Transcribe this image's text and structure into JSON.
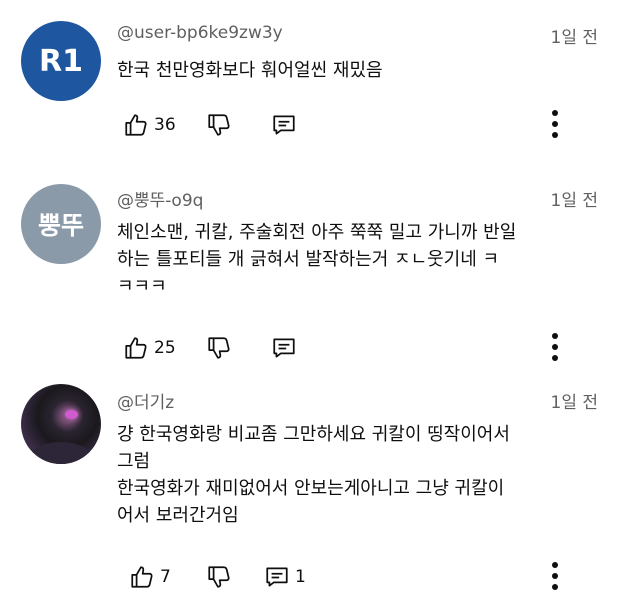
{
  "comments": [
    {
      "avatar_text": "R1",
      "handle": "@user-bp6ke9zw3y",
      "time": "1일 전",
      "text": "한국 천만영화보다 훠어얼씬 재밌음",
      "likes": "36",
      "replies": ""
    },
    {
      "avatar_text": "뿡뚜",
      "handle": "@뿡뚜-o9q",
      "time": "1일 전",
      "text": "체인소맨, 귀칼, 주술회전 아주 쭉쭉 밀고 가니까 반일\n하는 틀포티들 개 긁혀서 발작하는거 ㅈㄴ웃기네 ㅋ\nㅋㅋㅋ",
      "likes": "25",
      "replies": ""
    },
    {
      "avatar_text": "",
      "handle": "@더기z",
      "time": "1일 전",
      "text": "걍 한국영화랑 비교좀 그만하세요 귀칼이 띵작이어서\n그럼\n한국영화가 재미없어서 안보는게아니고 그냥 귀칼이\n어서 보러간거임",
      "likes": "7",
      "replies": "1"
    }
  ],
  "icons": {
    "like": "thumbs-up-icon",
    "dislike": "thumbs-down-icon",
    "reply": "reply-icon",
    "more": "more-vertical-icon"
  },
  "colors": {
    "avatar_r1": "#1e57a0",
    "avatar_pp": "#8a9aa8",
    "meta_text": "#606060",
    "body_text": "#0f0f0f"
  }
}
